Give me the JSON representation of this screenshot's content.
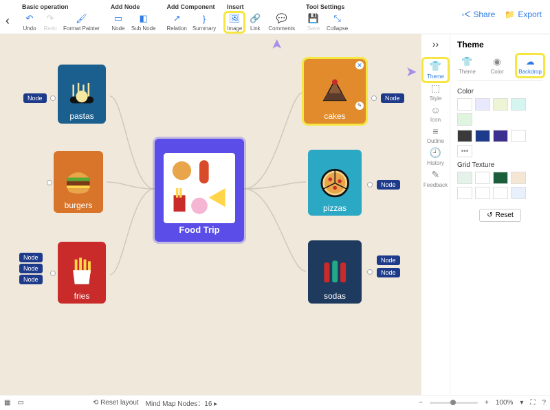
{
  "toolbar": {
    "groups": [
      {
        "title": "Basic operation",
        "items": [
          {
            "k": "undo",
            "l": "Undo",
            "ic": "↶"
          },
          {
            "k": "redo",
            "l": "Redo",
            "ic": "↷",
            "faded": true
          },
          {
            "k": "format-painter",
            "l": "Format Painter",
            "ic": "🖌"
          }
        ]
      },
      {
        "title": "Add Node",
        "items": [
          {
            "k": "node",
            "l": "Node",
            "ic": "▭"
          },
          {
            "k": "sub-node",
            "l": "Sub Node",
            "ic": "◧"
          }
        ]
      },
      {
        "title": "Add Component",
        "items": [
          {
            "k": "relation",
            "l": "Relation",
            "ic": "↗"
          },
          {
            "k": "summary",
            "l": "Summary",
            "ic": "}"
          }
        ]
      },
      {
        "title": "Insert",
        "items": [
          {
            "k": "image",
            "l": "Image",
            "ic": "🖼",
            "hl": true
          },
          {
            "k": "link",
            "l": "Link",
            "ic": "🔗"
          },
          {
            "k": "comments",
            "l": "Comments",
            "ic": "💬"
          }
        ]
      },
      {
        "title": "Tool Settings",
        "items": [
          {
            "k": "save",
            "l": "Save",
            "ic": "💾",
            "faded": true
          },
          {
            "k": "collapse",
            "l": "Collapse",
            "ic": "⤡"
          }
        ]
      }
    ]
  },
  "topActions": {
    "share": "Share",
    "export": "Export"
  },
  "mindmap": {
    "center": "Food Trip",
    "nodes": {
      "pastas": "pastas",
      "burgers": "burgers",
      "fries": "fries",
      "cakes": "cakes",
      "pizzas": "pizzas",
      "sodas": "sodas"
    },
    "tag": "Node"
  },
  "rail": [
    {
      "k": "theme",
      "l": "Theme",
      "ic": "👕",
      "hl": true
    },
    {
      "k": "style",
      "l": "Style",
      "ic": "⬚"
    },
    {
      "k": "icon",
      "l": "Icon",
      "ic": "☺"
    },
    {
      "k": "outline",
      "l": "Outline",
      "ic": "≡"
    },
    {
      "k": "history",
      "l": "History",
      "ic": "🕘"
    },
    {
      "k": "feedback",
      "l": "Feedback",
      "ic": "✎"
    }
  ],
  "panel": {
    "title": "Theme",
    "tabs": [
      {
        "k": "theme",
        "l": "Theme",
        "ic": "👕"
      },
      {
        "k": "color",
        "l": "Color",
        "ic": "◉"
      },
      {
        "k": "backdrop",
        "l": "Backdrop",
        "ic": "☁",
        "active": true
      }
    ],
    "colorTitle": "Color",
    "colors1": [
      "#ffffff",
      "#e8e8ff",
      "#eef5d4",
      "#d4f5f0",
      "#dff5e0"
    ],
    "colors2": [
      "#3a3a3a",
      "#1e3a8a",
      "#3b2f8f",
      "#ffffff"
    ],
    "gridTitle": "Grid Texture",
    "grids": [
      "#e4f2ea",
      "#fff",
      "#1b5e3a",
      "#f5e6d4",
      "#fff",
      "#fff",
      "#fff",
      "#e8f0fb"
    ],
    "reset": "Reset"
  },
  "status": {
    "resetLayout": "Reset layout",
    "nodesLabel": "Mind Map Nodes：",
    "nodeCount": "16",
    "zoom": "100%"
  }
}
